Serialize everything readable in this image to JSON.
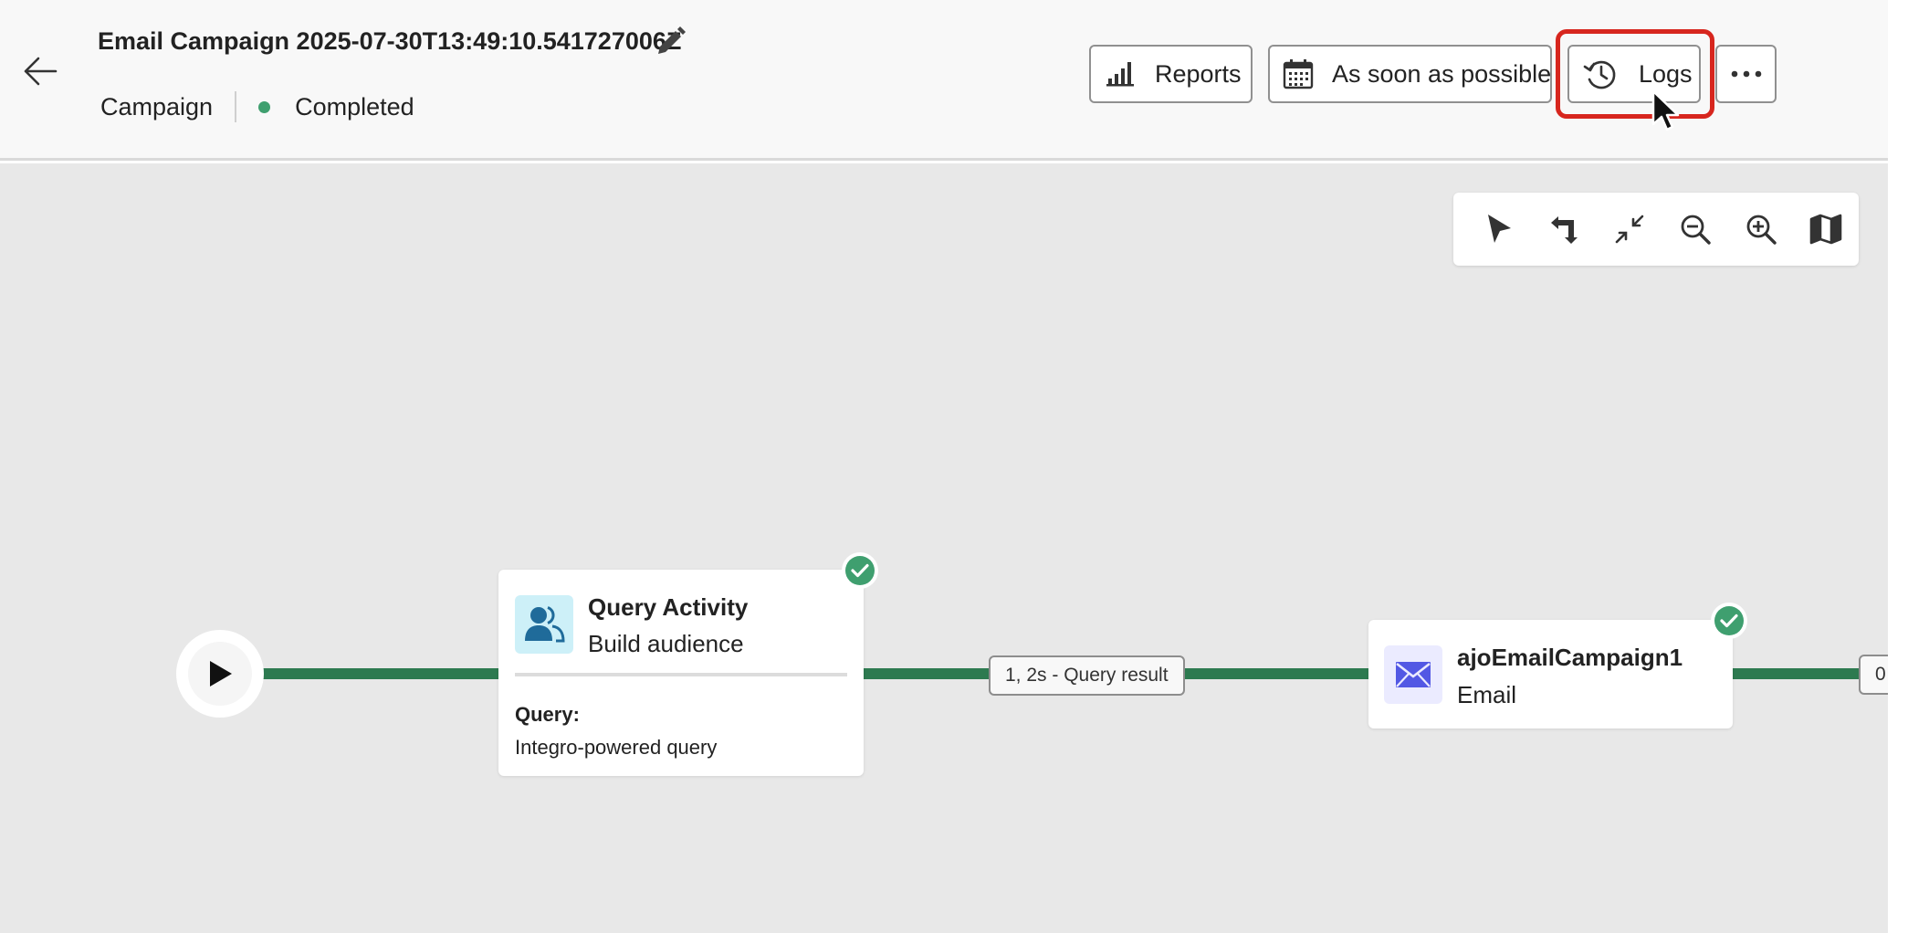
{
  "header": {
    "title": "Email Campaign 2025-07-30T13:49:10.541727006Z",
    "type_label": "Campaign",
    "status_label": "Completed",
    "status_color": "#3f9f6f",
    "reports_label": "Reports",
    "schedule_label": "As soon as possible",
    "logs_label": "Logs"
  },
  "toolbar": {
    "tools": [
      "select-icon",
      "reorganize-icon",
      "collapse-icon",
      "zoom-out-icon",
      "zoom-in-icon",
      "map-icon"
    ]
  },
  "workflow": {
    "query_activity": {
      "name": "Query Activity",
      "type": "Build audience",
      "query_label": "Query:",
      "query_value": "Integro-powered query",
      "icon": "audience-icon",
      "icon_bg": "#cdf0f8"
    },
    "transition_label": "1, 2s - Query result",
    "email_activity": {
      "name": "ajoEmailCampaign1",
      "type": "Email",
      "icon": "envelope-icon",
      "icon_bg": "#ebebff"
    },
    "next_transition_label": "0"
  },
  "colors": {
    "connector": "#2d7a50",
    "check": "#3f9f6f",
    "highlight": "#d7261e",
    "email_icon": "#5258e4",
    "audience_icon": "#1f6b9a"
  }
}
